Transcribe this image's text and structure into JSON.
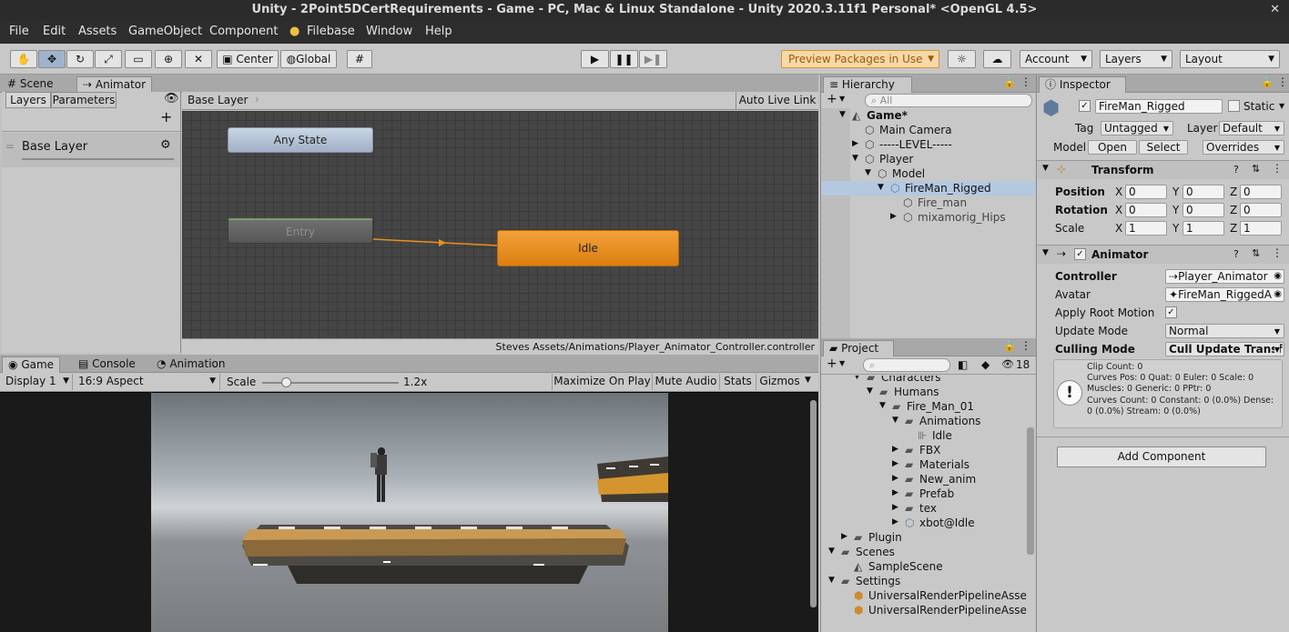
{
  "window": {
    "title": "Unity - 2Point5DCertRequirements - Game - PC, Mac & Linux Standalone - Unity 2020.3.11f1 Personal* <OpenGL 4.5>",
    "close": "✕"
  },
  "menu": [
    "File",
    "Edit",
    "Assets",
    "GameObject",
    "Component",
    "Filebase",
    "Window",
    "Help"
  ],
  "toolbar": {
    "tools": [
      "hand-tool",
      "move-tool",
      "rotate-tool",
      "scale-tool",
      "rect-tool",
      "transform-tool",
      "custom-tool"
    ],
    "pivot": "Center",
    "space": "Global",
    "preview_packages": "Preview Packages in Use",
    "account": "Account",
    "layers": "Layers",
    "layout": "Layout"
  },
  "animator": {
    "tabs": [
      "Scene",
      "Animator"
    ],
    "side_tabs": [
      "Layers",
      "Parameters"
    ],
    "plus": "+",
    "layer_name": "Base Layer",
    "breadcrumb": "Base Layer",
    "auto_live_link": "Auto Live Link",
    "states": {
      "any_state": "Any State",
      "entry": "Entry",
      "idle": "Idle"
    },
    "footer_path": "Steves Assets/Animations/Player_Animator_Controller.controller"
  },
  "game": {
    "tabs": [
      "Game",
      "Console",
      "Animation"
    ],
    "display": "Display 1",
    "aspect": "16:9 Aspect",
    "scale_label": "Scale",
    "scale_value": "1.2x",
    "scale_level": 0.05,
    "maximize": "Maximize On Play",
    "mute": "Mute Audio",
    "stats": "Stats",
    "gizmos": "Gizmos"
  },
  "hierarchy": {
    "tab": "Hierarchy",
    "search_placeholder": "All",
    "items": [
      {
        "label": "Game*",
        "depth": 0,
        "expanded": true,
        "bold": true,
        "icon": "unity-scene-icon"
      },
      {
        "label": "Main Camera",
        "depth": 1,
        "icon": "gameobject-icon"
      },
      {
        "label": "-----LEVEL-----",
        "depth": 1,
        "collapsed": true,
        "icon": "gameobject-icon"
      },
      {
        "label": "Player",
        "depth": 1,
        "expanded": true,
        "icon": "gameobject-icon"
      },
      {
        "label": "Model",
        "depth": 2,
        "expanded": true,
        "icon": "gameobject-icon"
      },
      {
        "label": "FireMan_Rigged",
        "depth": 3,
        "expanded": true,
        "selected": true,
        "icon": "prefab-icon"
      },
      {
        "label": "Fire_man",
        "depth": 4,
        "icon": "gameobject-icon"
      },
      {
        "label": "mixamorig_Hips",
        "depth": 4,
        "collapsed": true,
        "icon": "gameobject-icon"
      }
    ]
  },
  "project": {
    "tab": "Project",
    "count": "18",
    "items": [
      {
        "label": "Characters",
        "depth": 3
      },
      {
        "label": "Humans",
        "depth": 4,
        "expanded": true
      },
      {
        "label": "Fire_Man_01",
        "depth": 5,
        "expanded": true
      },
      {
        "label": "Animations",
        "depth": 6,
        "expanded": true
      },
      {
        "label": "Idle",
        "depth": 7,
        "icon": "anim-icon"
      },
      {
        "label": "FBX",
        "depth": 6,
        "collapsed": true
      },
      {
        "label": "Materials",
        "depth": 6,
        "collapsed": true
      },
      {
        "label": "New_anim",
        "depth": 6,
        "collapsed": true
      },
      {
        "label": "Prefab",
        "depth": 6,
        "collapsed": true
      },
      {
        "label": "tex",
        "depth": 6,
        "collapsed": true
      },
      {
        "label": "xbot@Idle",
        "depth": 6,
        "collapsed": true,
        "icon": "model-icon"
      },
      {
        "label": "Plugin",
        "depth": 2,
        "collapsed": true
      },
      {
        "label": "Scenes",
        "depth": 1,
        "expanded": true
      },
      {
        "label": "SampleScene",
        "depth": 2,
        "icon": "unity-scene-icon"
      },
      {
        "label": "Settings",
        "depth": 1,
        "expanded": true
      },
      {
        "label": "UniversalRenderPipelineAsse",
        "depth": 2,
        "icon": "asset-icon"
      },
      {
        "label": "UniversalRenderPipelineAsse",
        "depth": 2,
        "icon": "asset-icon"
      }
    ]
  },
  "inspector": {
    "tab": "Inspector",
    "object_name": "FireMan_Rigged",
    "static_label": "Static",
    "tag_label": "Tag",
    "tag_value": "Untagged",
    "layer_label": "Layer",
    "layer_value": "Default",
    "model_label": "Model",
    "open": "Open",
    "select": "Select",
    "overrides": "Overrides",
    "transform": {
      "title": "Transform",
      "rows": [
        {
          "label": "Position",
          "x": "0",
          "y": "0",
          "z": "0"
        },
        {
          "label": "Rotation",
          "x": "0",
          "y": "0",
          "z": "0"
        },
        {
          "label": "Scale",
          "x": "1",
          "y": "1",
          "z": "1"
        }
      ],
      "axis": [
        "X",
        "Y",
        "Z"
      ]
    },
    "animator": {
      "title": "Animator",
      "controller_label": "Controller",
      "controller_value": "Player_Animator",
      "avatar_label": "Avatar",
      "avatar_value": "FireMan_RiggedA",
      "apply_root_motion_label": "Apply Root Motion",
      "update_mode_label": "Update Mode",
      "update_mode_value": "Normal",
      "culling_mode_label": "Culling Mode",
      "culling_mode_value": "Cull Update Transf",
      "info": "Clip Count: 0\nCurves Pos: 0 Quat: 0 Euler: 0 Scale: 0\nMuscles: 0 Generic: 0 PPtr: 0\nCurves Count: 0 Constant: 0 (0.0%) Dense:\n0 (0.0%) Stream: 0 (0.0%)"
    },
    "add_component": "Add Component"
  },
  "colors": {
    "accent_orange": "#e8921c",
    "selection": "#b4c8e0",
    "dark_bar": "#2d2d2d"
  }
}
